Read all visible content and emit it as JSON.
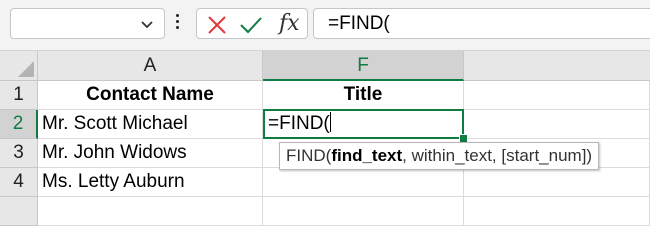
{
  "formula_bar": {
    "name_box_value": "",
    "cancel_icon": "x-icon",
    "enter_icon": "check-icon",
    "fx_label": "fx",
    "formula_text": "=FIND("
  },
  "columns": [
    "A",
    "F"
  ],
  "rows": [
    "1",
    "2",
    "3",
    "4"
  ],
  "cells": {
    "A1": "Contact Name",
    "F1": "Title",
    "A2": "Mr. Scott Michael",
    "F2": "=FIND(",
    "A3": "Mr. John Widows",
    "A4": "Ms. Letty Auburn"
  },
  "tooltip": {
    "fn": "FIND(",
    "arg1": "find_text",
    "rest": ", within_text, [start_num])"
  },
  "colors": {
    "accent": "#107c41",
    "cancel": "#e0393e"
  }
}
